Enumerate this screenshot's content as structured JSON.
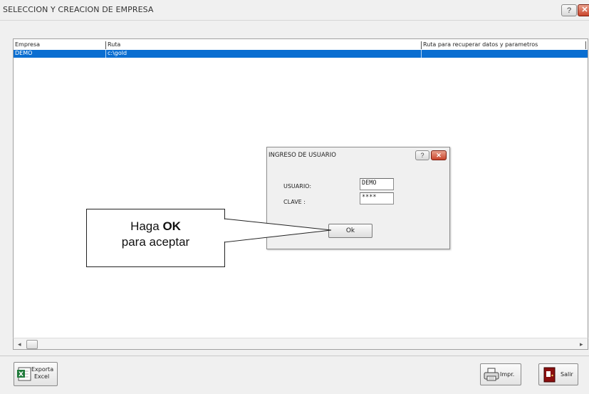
{
  "window": {
    "title": "SELECCION Y CREACION DE EMPRESA",
    "help_glyph": "?",
    "close_glyph": "✕"
  },
  "list": {
    "columns": [
      "Empresa",
      "Ruta",
      "Ruta para recuperar datos y parametros"
    ],
    "rows": [
      {
        "empresa": "DEMO",
        "ruta": "c:\\gold",
        "ruta_recuperar": ""
      }
    ]
  },
  "scrollbar": {
    "left_glyph": "◂",
    "right_glyph": "▸"
  },
  "buttons": {
    "exporta_line1": "Exporta",
    "exporta_line2": "Excel",
    "imprimir": "Impr.",
    "salir": "Salir"
  },
  "dialog": {
    "title": "INGRESO DE USUARIO",
    "usuario_label": "USUARIO:",
    "usuario_value": "DEMO",
    "clave_label": "CLAVE :",
    "clave_value": "****",
    "ok_label": "Ok"
  },
  "callout": {
    "pre": "Haga ",
    "bold": "OK",
    "line2": "para aceptar"
  },
  "colors": {
    "selection": "#0a6ed1",
    "close_button": "#c9452c"
  },
  "icons": [
    "help-icon",
    "close-icon",
    "excel-icon",
    "printer-icon",
    "exit-door-icon"
  ]
}
